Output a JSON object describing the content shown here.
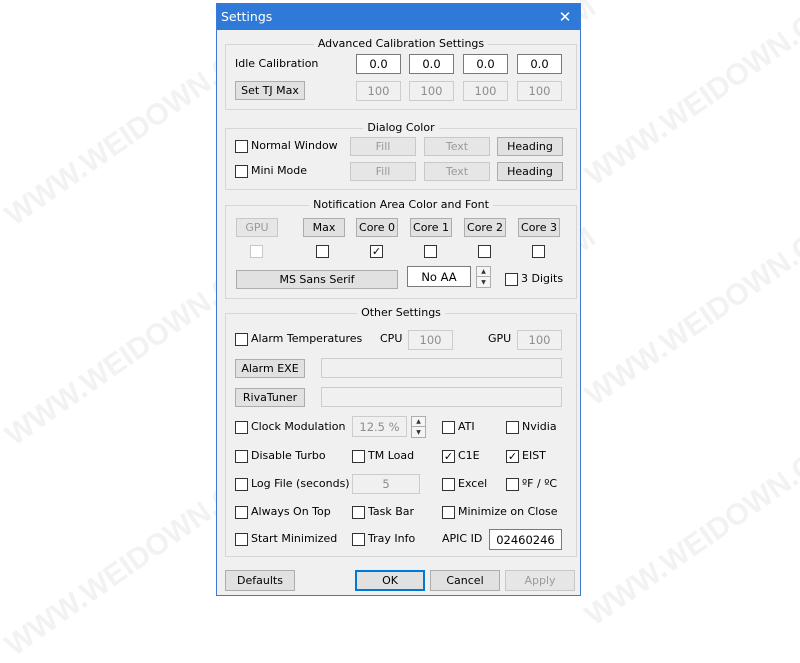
{
  "watermark": "WWW.WEIDOWN.COM",
  "window": {
    "title": "Settings"
  },
  "advanced": {
    "title": "Advanced Calibration Settings",
    "idle_label": "Idle Calibration",
    "idle_values": [
      "0.0",
      "0.0",
      "0.0",
      "0.0"
    ],
    "tj_button": "Set TJ Max",
    "tj_values": [
      "100",
      "100",
      "100",
      "100"
    ]
  },
  "dialog_color": {
    "title": "Dialog Color",
    "normal_window": "Normal Window",
    "mini_mode": "Mini Mode",
    "fill": "Fill",
    "text": "Text",
    "heading": "Heading"
  },
  "notification": {
    "title": "Notification Area Color and Font",
    "buttons": [
      "GPU",
      "Max",
      "Core 0",
      "Core 1",
      "Core 2",
      "Core 3"
    ],
    "checked": [
      false,
      false,
      true,
      false,
      false,
      false
    ],
    "font_button": "MS Sans Serif",
    "aa_value": "No AA",
    "three_digits": "3 Digits"
  },
  "other": {
    "title": "Other Settings",
    "alarm_temps": "Alarm Temperatures",
    "cpu_label": "CPU",
    "cpu_value": "100",
    "gpu_label": "GPU",
    "gpu_value": "100",
    "alarm_exe": "Alarm EXE",
    "rivatuner": "RivaTuner",
    "clock_mod": "Clock Modulation",
    "clock_value": "12.5 %",
    "ati": "ATI",
    "nvidia": "Nvidia",
    "disable_turbo": "Disable Turbo",
    "tm_load": "TM Load",
    "c1e": "C1E",
    "eist": "EIST",
    "log_file": "Log File (seconds)",
    "log_value": "5",
    "excel": "Excel",
    "fc": "ºF / ºC",
    "always_on_top": "Always On Top",
    "task_bar": "Task Bar",
    "minimize_on_close": "Minimize on Close",
    "start_minimized": "Start Minimized",
    "tray_info": "Tray Info",
    "apic_label": "APIC ID",
    "apic_value": "02460246"
  },
  "footer": {
    "defaults": "Defaults",
    "ok": "OK",
    "cancel": "Cancel",
    "apply": "Apply"
  },
  "icons": {
    "close": "close-icon",
    "check": "checkmark-icon"
  },
  "colors": {
    "titlebar": "#2f7ad8",
    "accent": "#0078d7",
    "face": "#f0f0f0"
  }
}
